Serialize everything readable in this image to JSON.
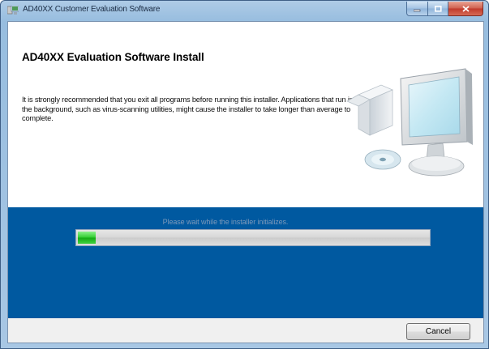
{
  "window": {
    "title": "AD40XX Customer Evaluation Software",
    "controls": {
      "minimize_icon": "minimize-icon",
      "maximize_icon": "maximize-icon",
      "close_icon": "close-icon"
    }
  },
  "content": {
    "heading": "AD40XX Evaluation Software Install",
    "body": "It is strongly recommended that you exit all programs before running this installer. Applications that run in the background, such as virus-scanning utilities, might cause the installer to take longer than average to complete.",
    "illustration_icon": "computer-installer-icon"
  },
  "progress": {
    "status": "Please wait while the installer initializes.",
    "fraction": 0.05
  },
  "footer": {
    "cancel_label": "Cancel"
  },
  "colors": {
    "band": "#0059a0",
    "progress_fill": "#22b822",
    "status_text": "#7a98ba"
  }
}
